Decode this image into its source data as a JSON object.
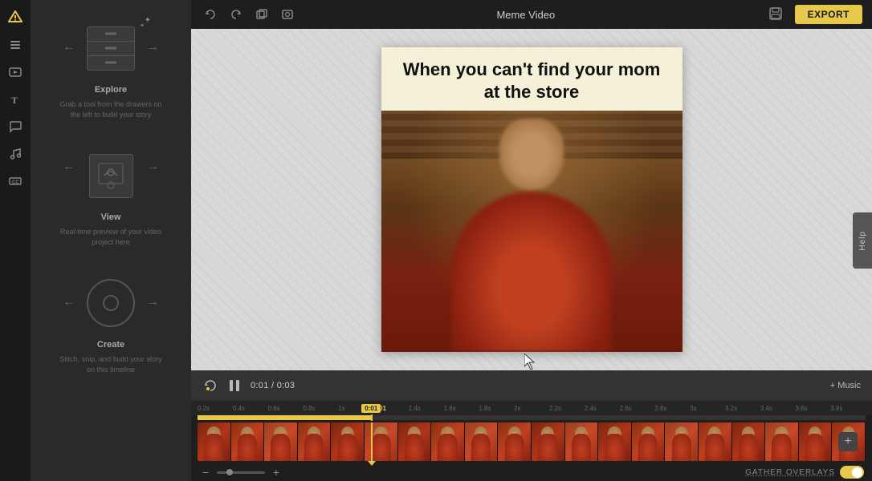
{
  "app": {
    "title": "Meme Video",
    "export_label": "EXPORT",
    "help_label": "Help"
  },
  "topbar": {
    "undo_label": "↩",
    "redo_label": "↪",
    "duplicate_label": "⧉",
    "screenshot_label": "⊡"
  },
  "sidebar": {
    "icons": [
      "logo",
      "layers",
      "media",
      "text",
      "comments",
      "music",
      "captions"
    ]
  },
  "tools": {
    "explore": {
      "title": "Explore",
      "description": "Grab a tool from the drawers on the left to build your story"
    },
    "view": {
      "title": "View",
      "description": "Real-time preview of your video project here"
    },
    "create": {
      "title": "Create",
      "description": "Stitch, snip, and build your story on this timeline"
    }
  },
  "meme": {
    "text": "When you can't find your mom at the store"
  },
  "controls": {
    "current_time": "0:01",
    "total_time": "0:03",
    "separator": "/",
    "music_label": "+ Music"
  },
  "timeline": {
    "ruler_marks": [
      "0.2s",
      "0.4s",
      "0.6s",
      "0.8s",
      "1s",
      "0:01",
      "1.4s",
      "1.6s",
      "1.8s",
      "2s",
      "2.2s",
      "2.4s",
      "2.6s",
      "2.8s",
      "3s",
      "3.2s",
      "3.4s",
      "3.6s",
      "3.8s"
    ],
    "playhead_time": "0:01",
    "progress_percent": 26,
    "gather_overlays_label": "GATHER OVERLAYS"
  }
}
